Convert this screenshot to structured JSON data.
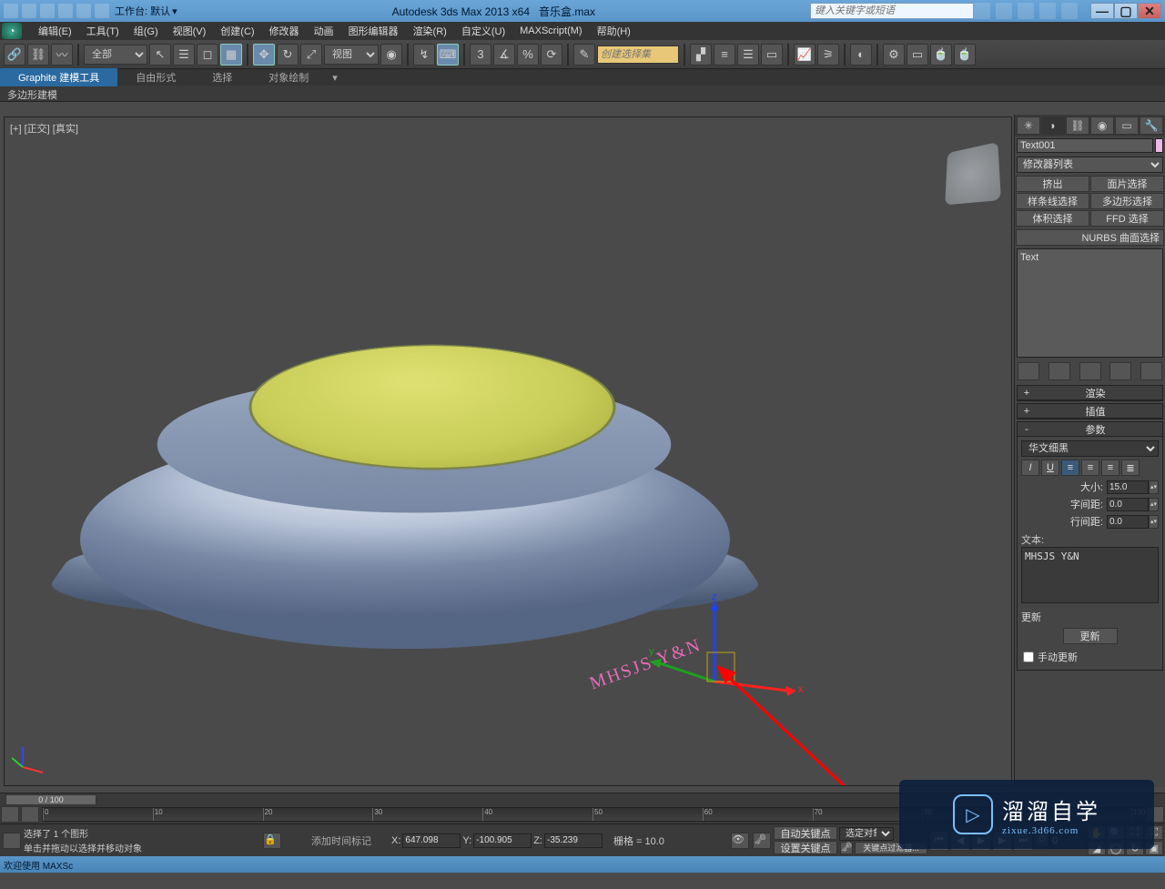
{
  "title": {
    "app": "Autodesk 3ds Max  2013 x64",
    "file": "音乐盒.max",
    "workspace_label": "工作台: 默认",
    "search_placeholder": "键入关键字或短语"
  },
  "menu": [
    "编辑(E)",
    "工具(T)",
    "组(G)",
    "视图(V)",
    "创建(C)",
    "修改器",
    "动画",
    "图形编辑器",
    "渲染(R)",
    "自定义(U)",
    "MAXScript(M)",
    "帮助(H)"
  ],
  "toolbar": {
    "filter_dd": "全部",
    "ref_dd": "视图",
    "named_set_placeholder": "创建选择集"
  },
  "ribbon": {
    "tabs": [
      "Graphite 建模工具",
      "自由形式",
      "选择",
      "对象绘制"
    ],
    "sub": "多边形建模"
  },
  "viewport": {
    "label": "[+] [正交] [真实]",
    "annotation_text": "MHSJS Y&N"
  },
  "cmd": {
    "object_name": "Text001",
    "modifier_dd": "修改器列表",
    "buttons": [
      "挤出",
      "面片选择",
      "样条线选择",
      "多边形选择",
      "体积选择",
      "FFD 选择"
    ],
    "nurbs_btn": "NURBS 曲面选择",
    "stack_item": "Text",
    "rollouts": {
      "render": "渲染",
      "interp": "插值",
      "params": "参数"
    },
    "font": "华文细黑",
    "size_label": "大小:",
    "size_val": "15.0",
    "kern_label": "字间距:",
    "kern_val": "0.0",
    "lead_label": "行间距:",
    "lead_val": "0.0",
    "text_label": "文本:",
    "text_val": "MHSJS Y&N",
    "update_section": "更新",
    "update_btn": "更新",
    "manual_chk": "手动更新"
  },
  "status": {
    "slider_val": "0 / 100",
    "sel_msg": "选择了 1 个图形",
    "hint_msg": "单击并拖动以选择并移动对象",
    "add_time": "添加时间标记",
    "x_label": "X:",
    "x_val": "647.098",
    "y_label": "Y:",
    "y_val": "-100.905",
    "z_label": "Z:",
    "z_val": "-35.239",
    "grid_label": "栅格 = 10.0",
    "autokey": "自动关键点",
    "setkey": "设置关键点",
    "keyfilter": "关键点过滤器...",
    "selkey": "选定对象",
    "frame": "0",
    "welcome": "欢迎使用 MAXSc"
  },
  "logo": {
    "cn": "溜溜自学",
    "url": "zixue.3d66.com"
  }
}
